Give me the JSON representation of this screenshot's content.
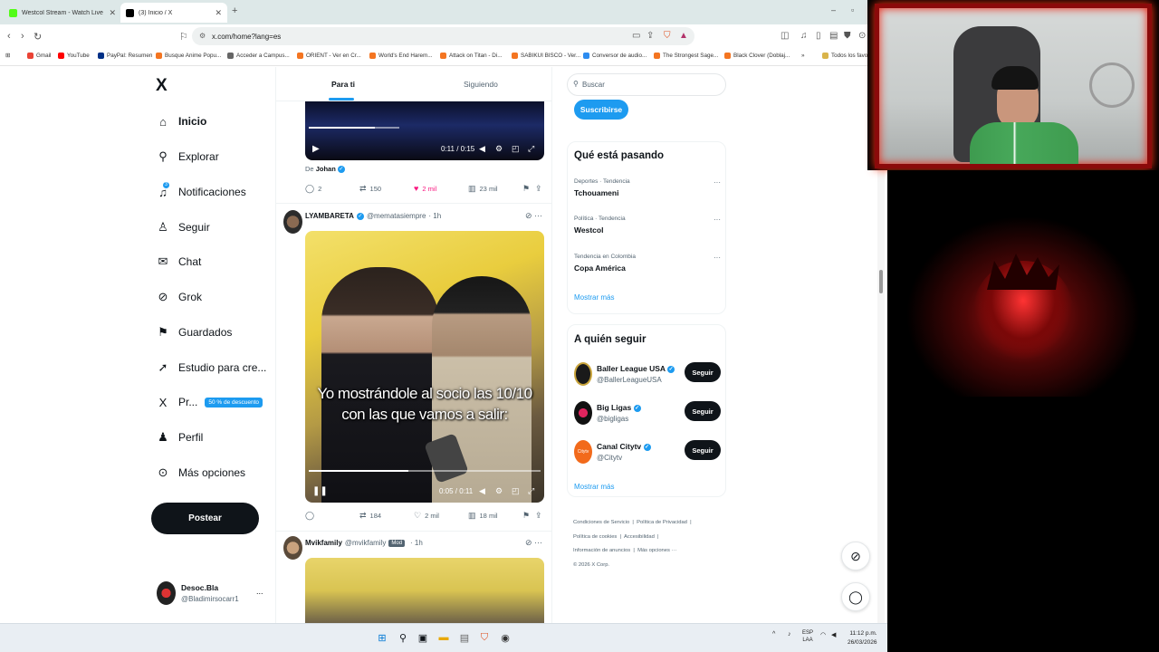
{
  "browser": {
    "tabs": [
      {
        "title": "Westcol Stream - Watch Live on Kick",
        "fav_color": "#53fc18"
      },
      {
        "title": "(3) Inicio / X",
        "fav_color": "#000000"
      }
    ],
    "url": "x.com/home?lang=es",
    "bookmarks": [
      "Gmail",
      "YouTube",
      "PayPal: Resumen",
      "Busque Anime Popu...",
      "Acceder a Campus...",
      "ORIENT - Ver en Cr...",
      "World's End Harem...",
      "Attack on Titan - Di...",
      "SABIKUI BISCO - Ver...",
      "Conversor de audio...",
      "The Strongest Sage...",
      "Black Clover (Doblaj...",
      "Todos los favoritos"
    ],
    "bookmark_overflow": "»"
  },
  "sidebar": {
    "logo": "X",
    "items": [
      {
        "label": "Inicio",
        "icon": "home-icon",
        "glyph": "⌂"
      },
      {
        "label": "Explorar",
        "icon": "search-icon",
        "glyph": "⚲"
      },
      {
        "label": "Notificaciones",
        "icon": "bell-icon",
        "glyph": "♫",
        "badge": "3"
      },
      {
        "label": "Seguir",
        "icon": "follow-icon",
        "glyph": "♙"
      },
      {
        "label": "Chat",
        "icon": "mail-icon",
        "glyph": "✉"
      },
      {
        "label": "Grok",
        "icon": "grok-icon",
        "glyph": "⊘"
      },
      {
        "label": "Guardados",
        "icon": "bookmark-icon",
        "glyph": "⚑"
      },
      {
        "label": "Estudio para cre...",
        "icon": "rocket-icon",
        "glyph": "➚"
      },
      {
        "label": "Pr...",
        "icon": "x-premium-icon",
        "glyph": "X",
        "promo": "50 % de descuento"
      },
      {
        "label": "Perfil",
        "icon": "person-icon",
        "glyph": "♟"
      },
      {
        "label": "Más opciones",
        "icon": "more-circle-icon",
        "glyph": "⊙"
      }
    ],
    "post_button": "Postear",
    "account": {
      "name": "Desoc.Bla",
      "handle": "@Bladimirsocarr1",
      "more": "..."
    }
  },
  "timeline": {
    "tabs": [
      "Para ti",
      "Siguiendo"
    ],
    "post1": {
      "video_time": "0:11 / 0:15",
      "video_progress": 0.73,
      "from_prefix": "De",
      "from_name": "Johan",
      "replies": "2",
      "reposts": "150",
      "likes": "2 mil",
      "views": "23 mil"
    },
    "post2": {
      "name": "LYAMBARETA",
      "handle": "@mematasiempre",
      "time": "· 1h",
      "subtitle_line1": "Yo mostrándole al socio las 10/10",
      "subtitle_line2": "con las que vamos a salir:",
      "video_time": "0:05 / 0:11",
      "video_progress": 0.43,
      "reposts": "184",
      "likes": "2 mil",
      "views": "18 mil"
    },
    "post3": {
      "name": "Mvikfamily",
      "handle": "@mvikfamily",
      "tag": "Mod",
      "time": "· 1h"
    }
  },
  "right": {
    "search_placeholder": "Buscar",
    "subscribe": "Suscribirse",
    "trends_title": "Qué está pasando",
    "trends": [
      {
        "context": "Deportes · Tendencia",
        "name": "Tchouameni"
      },
      {
        "context": "Política · Tendencia",
        "name": "Westcol"
      },
      {
        "context": "Tendencia en Colombia",
        "name": "Copa América"
      }
    ],
    "show_more": "Mostrar más",
    "who_title": "A quién seguir",
    "who": [
      {
        "name": "Baller League USA",
        "handle": "@BallerLeagueUSA",
        "button": "Seguir",
        "color": "#1a1a1a"
      },
      {
        "name": "Big Ligas",
        "handle": "@bigligas",
        "button": "Seguir",
        "color": "#111111"
      },
      {
        "name": "Canal Citytv",
        "handle": "@Citytv",
        "button": "Seguir",
        "color": "#f26a1b"
      }
    ],
    "footer": [
      "Condiciones de Servicio",
      "Política de Privacidad",
      "Política de cookies",
      "Accesibilidad",
      "Información de anuncios",
      "Más opciones ···",
      "© 2026 X Corp."
    ]
  },
  "taskbar": {
    "lang": "ESP",
    "lang2": "LAA",
    "time": "11:12 p.m.",
    "date": "26/03/2026"
  }
}
